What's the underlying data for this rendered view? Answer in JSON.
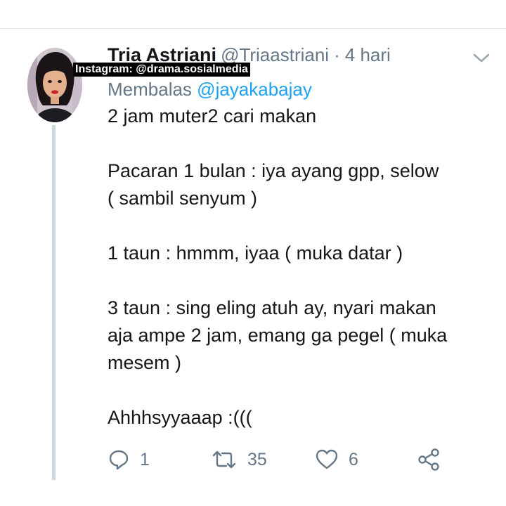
{
  "tweet": {
    "display_name": "Tria Astriani",
    "handle": "@Triaastriani",
    "separator": "·",
    "time": "4 hari",
    "reply_prefix": "Membalas",
    "reply_mention": "@jayakabajay",
    "lines": [
      "2 jam muter2 cari makan",
      "",
      "Pacaran 1 bulan : iya ayang gpp, selow",
      "( sambil senyum )",
      "",
      "1 taun : hmmm, iyaa ( muka datar )",
      "",
      "3 taun : sing eling atuh ay, nyari makan",
      "aja ampe 2 jam, emang ga pegel ( muka",
      "mesem )",
      "",
      "Ahhhsyyaaap :((("
    ]
  },
  "watermark": "Instagram: @drama.sosialmedia",
  "actions": {
    "reply": {
      "icon": "reply-icon",
      "count": "1"
    },
    "retweet": {
      "icon": "retweet-icon",
      "count": "35"
    },
    "like": {
      "icon": "heart-icon",
      "count": "6"
    },
    "share": {
      "icon": "share-icon"
    }
  },
  "colors": {
    "text": "#14171a",
    "secondary": "#657786",
    "link": "#1da1f2",
    "thread_line": "#ccd6dd"
  }
}
